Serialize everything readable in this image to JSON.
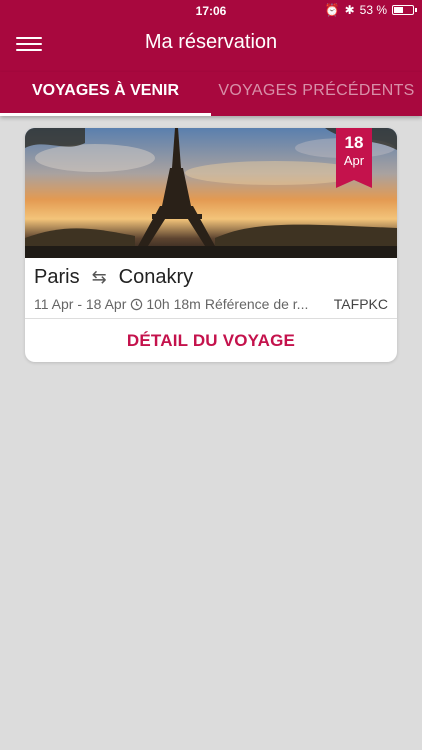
{
  "status_bar": {
    "time": "17:06",
    "battery_percent_label": "53 %",
    "battery_level": 0.53,
    "icons": [
      "alarm-icon",
      "bluetooth-icon",
      "battery-icon"
    ]
  },
  "header": {
    "title": "Ma réservation",
    "menu_icon": "hamburger-menu-icon"
  },
  "tabs": [
    {
      "label": "VOYAGES À VENIR",
      "active": true
    },
    {
      "label": "VOYAGES PRÉCÉDENTS",
      "active": false
    }
  ],
  "trips": [
    {
      "image": "eiffel-tower-photo",
      "badge": {
        "day": "18",
        "month": "Apr"
      },
      "origin": "Paris",
      "destination": "Conakry",
      "route_icon": "swap-arrows-icon",
      "dates": "11 Apr - 18 Apr",
      "duration": "10h 18m",
      "reference_label": "Référence de r...",
      "reference_code": "TAFPKC",
      "detail_button": "DÉTAIL DU VOYAGE"
    }
  ],
  "colors": {
    "primary": "#a8083e",
    "accent": "#c4124c",
    "background": "#dcdcdc"
  }
}
